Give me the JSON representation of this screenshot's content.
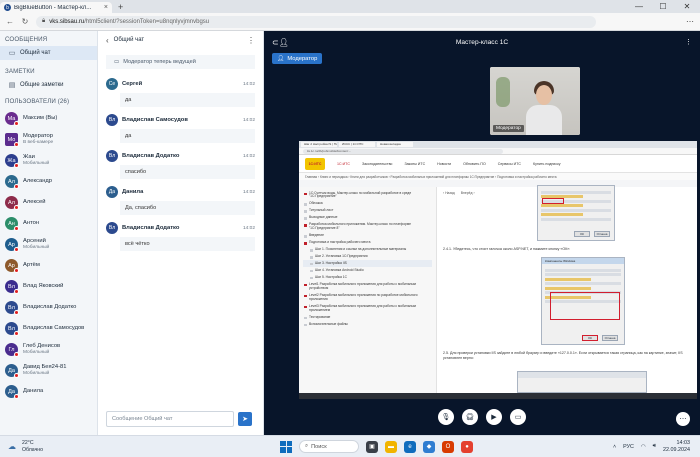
{
  "browser": {
    "tab_title": "BigBlueButton - Мастер-кл...",
    "url_domain": "vks.sibsau.ru",
    "url_path": "/html5client/?sessionToken=u8nqnlyvjmnvbgsu"
  },
  "sidebar": {
    "messages_title": "СООБЩЕНИЯ",
    "public_chat_label": "Общий чат",
    "notes_title": "ЗАМЕТКИ",
    "shared_notes_label": "Общие заметки",
    "users_title": "ПОЛЬЗОВАТЕЛИ (26)",
    "users": [
      {
        "initials": "Ма",
        "name": "Максим (Вы)",
        "sub": "",
        "color": "#6a2c8e",
        "shape": "round"
      },
      {
        "initials": "Мо",
        "name": "Модератор",
        "sub": "В веб-камере",
        "color": "#5b2c8e",
        "shape": "square"
      },
      {
        "initials": "Жа",
        "name": "Жаи",
        "sub": "Мобильный",
        "color": "#2c3e8e",
        "shape": "round"
      },
      {
        "initials": "Ал",
        "name": "Александр",
        "sub": "",
        "color": "#2c6a8e",
        "shape": "round"
      },
      {
        "initials": "Ал",
        "name": "Алексей",
        "sub": "",
        "color": "#8e2c4a",
        "shape": "round"
      },
      {
        "initials": "Ан",
        "name": "Антон",
        "sub": "",
        "color": "#2c8e6a",
        "shape": "round"
      },
      {
        "initials": "Ар",
        "name": "Арсений",
        "sub": "Мобильный",
        "color": "#1f5e8e",
        "shape": "round"
      },
      {
        "initials": "Ар",
        "name": "Артём",
        "sub": "",
        "color": "#8e5a2c",
        "shape": "round"
      },
      {
        "initials": "Вл",
        "name": "Влад Яковский",
        "sub": "",
        "color": "#3a2c8e",
        "shape": "round"
      },
      {
        "initials": "Вл",
        "name": "Владислав Додатко",
        "sub": "",
        "color": "#2c4a8e",
        "shape": "round"
      },
      {
        "initials": "Вл",
        "name": "Владислав Самосудов",
        "sub": "",
        "color": "#2c4a8e",
        "shape": "round"
      },
      {
        "initials": "Гл",
        "name": "Глеб Денисов",
        "sub": "Мобильный",
        "color": "#4a2c8e",
        "shape": "round"
      },
      {
        "initials": "Да",
        "name": "Давид Бея24-81",
        "sub": "Мобильный",
        "color": "#2c5e8e",
        "shape": "round"
      },
      {
        "initials": "Да",
        "name": "Данила",
        "sub": "",
        "color": "#2c5e8e",
        "shape": "round"
      }
    ]
  },
  "chat": {
    "title": "Общий чат",
    "system_message": "Модератор теперь ведущей",
    "messages": [
      {
        "initials": "Се",
        "name": "Сергей",
        "time": "14:02",
        "text": "да",
        "color": "#2c6a8e"
      },
      {
        "initials": "Вл",
        "name": "Владислав Самосудов",
        "time": "14:02",
        "text": "да",
        "color": "#2c4a8e"
      },
      {
        "initials": "Вл",
        "name": "Владислав Додатко",
        "time": "14:02",
        "text": "спасибо",
        "color": "#2c4a8e"
      },
      {
        "initials": "Да",
        "name": "Данила",
        "time": "14:02",
        "text": "Да, спасибо",
        "color": "#2c5e8e"
      },
      {
        "initials": "Вл",
        "name": "Владислав Додатко",
        "time": "14:02",
        "text": "всё чётко",
        "color": "#2c4a8e"
      }
    ],
    "input_placeholder": "Сообщение Общий чат"
  },
  "main": {
    "title": "Мастер-класс 1С",
    "moderator_badge": "Модератор",
    "webcam_label": "Модератор"
  },
  "screen": {
    "tabs": [
      "Шаг 2 Настройка IS | Поз...",
      "ИСКС | 1С:ИТС",
      "Новая вкладка"
    ],
    "url": "its.1c.ru/db/pubmobile#content:...",
    "logo": "1С:ИТС",
    "nav": [
      "1С:ИТС",
      "Законодательство",
      "Законы ИТС",
      "Новости",
      "Обновить ПО",
      "Сервисы ИТС",
      "Купить подписку"
    ],
    "breadcrumb": "Главная › Книги и периодика › Книги для разработчиков › Разработка мобильных приложений для платформы 1С:Предприятие › Подготовка и настройка рабочего места",
    "toc": [
      {
        "text": "1С:Счетчик воды. Мастер-класс по мобильной разработке в среде \"1С:Предприятие\"",
        "level": 0,
        "red": true
      },
      {
        "text": "Обложка",
        "level": 0
      },
      {
        "text": "Титульный лист",
        "level": 0
      },
      {
        "text": "Выходные данные",
        "level": 0
      },
      {
        "text": "Разработка мобильного приложения. Мастер-класс по платформе \"1С:Предприятие 8\"",
        "level": 0,
        "red": true
      },
      {
        "text": "Введение",
        "level": 0
      },
      {
        "text": "Подготовка и настройка рабочего места",
        "level": 0,
        "red": true
      },
      {
        "text": "Шаг 1. Пояснения и ссылки на дополнительные материалы",
        "level": 1
      },
      {
        "text": "Шаг 2. Установка 1С:Предприятия",
        "level": 1
      },
      {
        "text": "Шаг 3. Настройка IIS",
        "level": 1,
        "cur": true
      },
      {
        "text": "Шаг 4. Установка Android Studio",
        "level": 1
      },
      {
        "text": "Шаг 5. Настройка 1С",
        "level": 1
      },
      {
        "text": "Level1 Разработка мобильного приложения для работы с мобильным устройством",
        "level": 0,
        "red": true
      },
      {
        "text": "Level2 Разработка мобильного приложения по разработке мобильного приложения",
        "level": 0,
        "red": true
      },
      {
        "text": "Level3 Разработка мобильного приложения для работы с мобильным приложением",
        "level": 0,
        "red": true
      },
      {
        "text": "Тестирование",
        "level": 0
      },
      {
        "text": "Вспомогательные файлы",
        "level": 0
      }
    ],
    "pager_prev": "‹ Назад",
    "pager_next": "Вперёд ›",
    "text1": "2.4.1. Убедитесь, что стоит галочка около ASP.NET, и нажмите кнопку «ОК»:",
    "text2": "2.5. Для проверки установки IIS зайдите в любой браузер и введите «127.0.0.1». Если открывается такая страница, как на картинке, значит, IIS установлен верно:",
    "win1_title": "Компоненты Windows",
    "win2_title": "Компоненты Windows",
    "ok_label": "ОК",
    "cancel_label": "Отмена"
  },
  "taskbar": {
    "weather_temp": "22°C",
    "weather_desc": "Облачно",
    "search_label": "Поиск",
    "lang": "РУС",
    "time": "14:03",
    "date": "22.09.2024"
  }
}
